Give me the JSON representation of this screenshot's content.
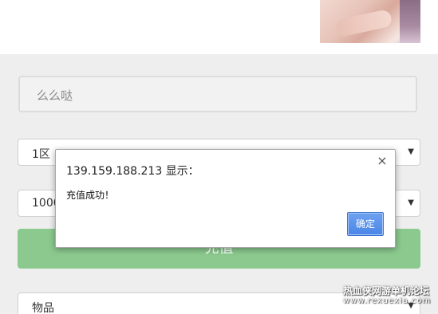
{
  "name_field": {
    "value": "么么哒"
  },
  "server_select": {
    "selected": "1区"
  },
  "amount_select": {
    "selected": "1000"
  },
  "recharge_button": {
    "label": "充值"
  },
  "item_select": {
    "selected": "物品"
  },
  "dialog": {
    "title": "139.159.188.213 显示：",
    "close_glyph": "×",
    "message": "充值成功！",
    "ok_label": "确定"
  },
  "select_arrow": "▼",
  "watermark": {
    "line1": "热血侠网游单机论坛",
    "line2": "www.rexuexia.com"
  },
  "colors": {
    "recharge_button": "#8bc98e",
    "ok_button": "#4a86e8",
    "form_background": "#eeeeee"
  }
}
